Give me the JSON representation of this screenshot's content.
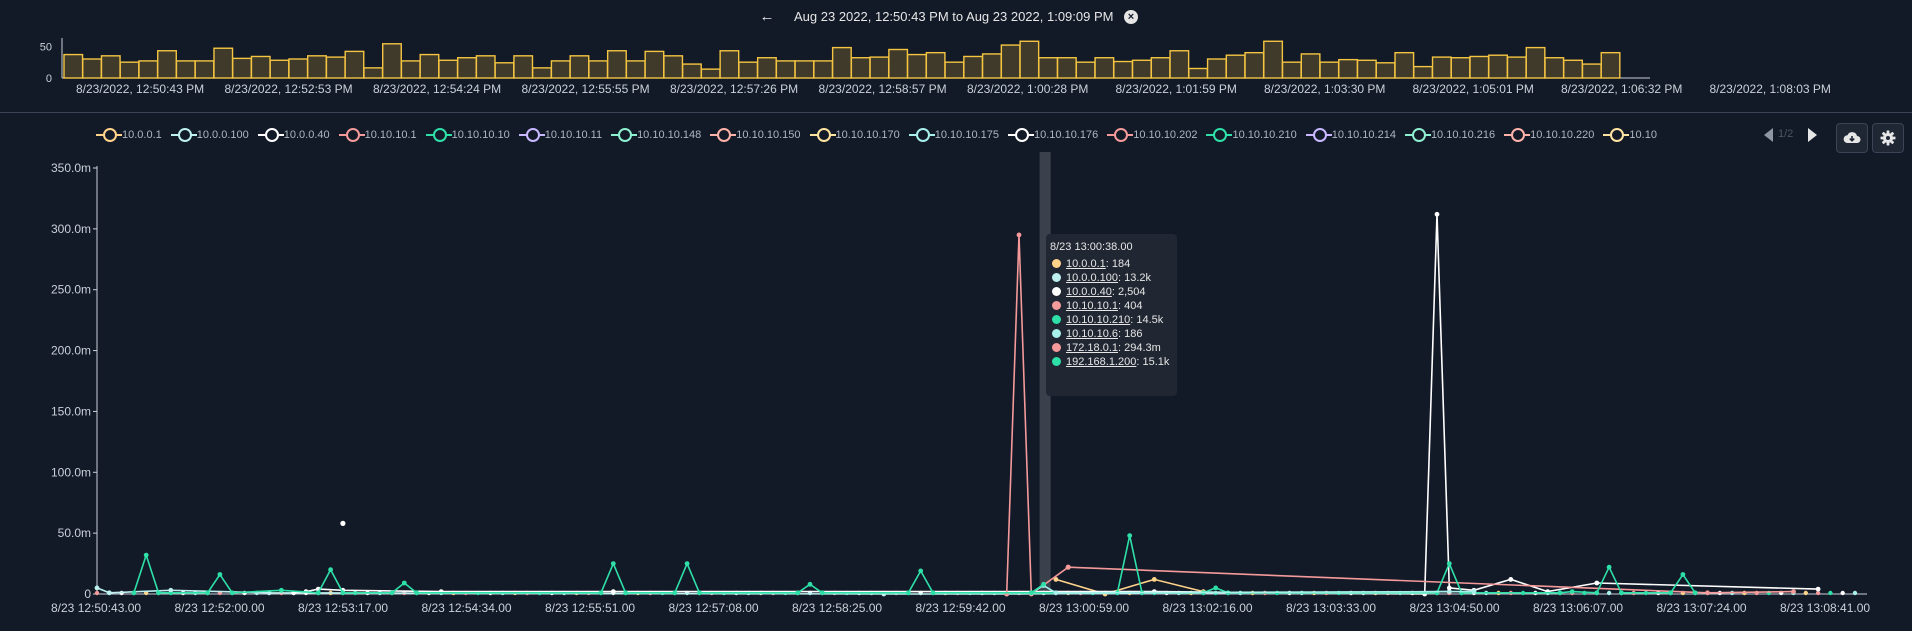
{
  "header": {
    "range_label": "Aug 23 2022, 12:50:43 PM to Aug 23 2022, 1:09:09 PM",
    "back_icon": "arrow-left-icon",
    "clear_icon": "close-circle-icon"
  },
  "colors": {
    "background": "#121927",
    "overview_bar_fill": "#3f3a2a",
    "overview_bar_stroke": "#f5c542",
    "axis": "#c9d1d9",
    "grid_label": "#c9d1d9",
    "highlight_band": "#3b414c"
  },
  "legend": {
    "items": [
      {
        "label": "10.0.0.1",
        "color": "#ffd38a"
      },
      {
        "label": "10.0.0.100",
        "color": "#bdf0ee"
      },
      {
        "label": "10.0.0.40",
        "color": "#ffffff"
      },
      {
        "label": "10.10.10.1",
        "color": "#f59a9a"
      },
      {
        "label": "10.10.10.10",
        "color": "#2ee0a8"
      },
      {
        "label": "10.10.10.11",
        "color": "#c9b8ff"
      },
      {
        "label": "10.10.10.148",
        "color": "#8ef0d0"
      },
      {
        "label": "10.10.10.150",
        "color": "#ffb3a8"
      },
      {
        "label": "10.10.10.170",
        "color": "#ffe3a0"
      },
      {
        "label": "10.10.10.175",
        "color": "#a8f0ec"
      },
      {
        "label": "10.10.10.176",
        "color": "#ffffff"
      },
      {
        "label": "10.10.10.202",
        "color": "#f59a9a"
      },
      {
        "label": "10.10.10.210",
        "color": "#2ee0a8"
      },
      {
        "label": "10.10.10.214",
        "color": "#c9b8ff"
      },
      {
        "label": "10.10.10.216",
        "color": "#8ef0d0"
      },
      {
        "label": "10.10.10.220",
        "color": "#ffb3a8"
      },
      {
        "label": "10.10",
        "color": "#ffe3a0"
      }
    ],
    "page_text": "1/2",
    "prev_icon": "triangle-left-icon",
    "next_icon": "triangle-right-icon"
  },
  "toolbar": {
    "download_icon": "cloud-download-icon",
    "settings_icon": "gear-icon"
  },
  "tooltip": {
    "title": "8/23 13:00:38.00",
    "rows": [
      {
        "host": "10.0.0.1",
        "value": ": 184",
        "color": "#ffd38a"
      },
      {
        "host": "10.0.0.100",
        "value": ": 13.2k",
        "color": "#bdf0ee"
      },
      {
        "host": "10.0.0.40",
        "value": ": 2,504",
        "color": "#ffffff"
      },
      {
        "host": "10.10.10.1",
        "value": ": 404",
        "color": "#f59a9a"
      },
      {
        "host": "10.10.10.210",
        "value": ": 14.5k",
        "color": "#2ee0a8"
      },
      {
        "host": "10.10.10.6",
        "value": ": 186",
        "color": "#a8f0ec"
      },
      {
        "host": "172.18.0.1",
        "value": ": 294.3m",
        "color": "#f59a9a"
      },
      {
        "host": "192.168.1.200",
        "value": ": 15.1k",
        "color": "#2ee0a8"
      }
    ]
  },
  "chart_data": [
    {
      "type": "bar",
      "name": "overview",
      "ylim": [
        0,
        60
      ],
      "y_ticks": [
        "50",
        "0"
      ],
      "y_tick_values": [
        50,
        0
      ],
      "x_tick_labels": [
        "8/23/2022, 12:50:43 PM",
        "8/23/2022, 12:52:53 PM",
        "8/23/2022, 12:54:24 PM",
        "8/23/2022, 12:55:55 PM",
        "8/23/2022, 12:57:26 PM",
        "8/23/2022, 12:58:57 PM",
        "8/23/2022, 1:00:28 PM",
        "8/23/2022, 1:01:59 PM",
        "8/23/2022, 1:03:30 PM",
        "8/23/2022, 1:05:01 PM",
        "8/23/2022, 1:06:32 PM",
        "8/23/2022, 1:08:03 PM"
      ],
      "values": [
        37,
        30,
        35,
        25,
        27,
        43,
        27,
        27,
        47,
        31,
        34,
        28,
        30,
        35,
        33,
        42,
        16,
        54,
        27,
        37,
        28,
        32,
        35,
        24,
        35,
        16,
        27,
        35,
        27,
        43,
        27,
        42,
        35,
        22,
        14,
        43,
        25,
        32,
        27,
        27,
        27,
        48,
        32,
        33,
        45,
        37,
        40,
        25,
        34,
        38,
        52,
        58,
        32,
        32,
        25,
        32,
        26,
        28,
        32,
        43,
        15,
        30,
        36,
        40,
        58,
        25,
        38,
        25,
        29,
        28,
        24,
        40,
        18,
        33,
        32,
        34,
        36,
        33,
        48,
        32,
        28,
        22,
        40
      ]
    },
    {
      "type": "line",
      "name": "main",
      "ylim": [
        0,
        350
      ],
      "y_ticks": [
        "350.0m",
        "300.0m",
        "250.0m",
        "200.0m",
        "150.0m",
        "100.0m",
        "50.0m",
        "0"
      ],
      "y_tick_values": [
        350,
        300,
        250,
        200,
        150,
        100,
        50,
        0
      ],
      "x_tick_labels": [
        "8/23 12:50:43.00",
        "8/23 12:52:00.00",
        "8/23 12:53:17.00",
        "8/23 12:54:34.00",
        "8/23 12:55:51.00",
        "8/23 12:57:08.00",
        "8/23 12:58:25.00",
        "8/23 12:59:42.00",
        "8/23 13:00:59.00",
        "8/23 13:02:16.00",
        "8/23 13:03:33.00",
        "8/23 13:04:50.00",
        "8/23 13:06:07.00",
        "8/23 13:07:24.00",
        "8/23 13:08:41.00"
      ],
      "highlight_index": 77,
      "n_points": 144,
      "series": [
        {
          "name": "10.0.0.1",
          "color": "#ffd38a",
          "points": [
            [
              78,
              12
            ],
            [
              82,
              0
            ],
            [
              86,
              12
            ],
            [
              90,
              2
            ]
          ]
        },
        {
          "name": "10.0.0.100",
          "color": "#bdf0ee",
          "points": [
            [
              0,
              5
            ],
            [
              1,
              1
            ],
            [
              6,
              3
            ],
            [
              14,
              1
            ],
            [
              64,
              0
            ],
            [
              74,
              0
            ],
            [
              110,
              2
            ]
          ]
        },
        {
          "name": "10.0.0.40",
          "color": "#ffffff",
          "points": [
            [
              16,
              1
            ],
            [
              17,
              2
            ],
            [
              18,
              4
            ],
            [
              20,
              3
            ],
            [
              28,
              2
            ],
            [
              42,
              2
            ],
            [
              86,
              2
            ],
            [
              108,
              0
            ],
            [
              109,
              312
            ],
            [
              110,
              5
            ],
            [
              112,
              3
            ],
            [
              115,
              12
            ],
            [
              118,
              2
            ],
            [
              122,
              9
            ],
            [
              140,
              4
            ]
          ]
        },
        {
          "name": "10.10.10.1",
          "color": "#f59a9a",
          "points": [
            [
              74,
              0
            ],
            [
              75,
              295
            ],
            [
              76,
              0
            ],
            [
              79,
              22
            ],
            [
              131,
              1
            ],
            [
              138,
              2
            ]
          ]
        },
        {
          "name": "10.10.10.210",
          "color": "#2ee0a8",
          "points": [
            [
              3,
              1
            ],
            [
              4,
              32
            ],
            [
              5,
              1
            ],
            [
              9,
              1
            ],
            [
              10,
              16
            ],
            [
              11,
              1
            ],
            [
              15,
              3
            ],
            [
              18,
              1
            ],
            [
              19,
              20
            ],
            [
              20,
              1
            ],
            [
              24,
              1
            ],
            [
              25,
              9
            ],
            [
              26,
              1
            ],
            [
              41,
              1
            ],
            [
              42,
              25
            ],
            [
              43,
              1
            ],
            [
              47,
              1
            ],
            [
              48,
              25
            ],
            [
              49,
              1
            ],
            [
              57,
              1
            ],
            [
              58,
              8
            ],
            [
              59,
              1
            ],
            [
              66,
              1
            ],
            [
              67,
              19
            ],
            [
              68,
              1
            ],
            [
              83,
              1
            ],
            [
              84,
              48
            ],
            [
              85,
              1
            ],
            [
              90,
              1
            ],
            [
              91,
              5
            ],
            [
              92,
              1
            ],
            [
              109,
              1
            ],
            [
              110,
              25
            ],
            [
              111,
              1
            ],
            [
              119,
              1
            ],
            [
              120,
              2
            ],
            [
              122,
              1
            ],
            [
              123,
              22
            ],
            [
              124,
              1
            ],
            [
              128,
              1
            ],
            [
              129,
              16
            ],
            [
              130,
              1
            ]
          ]
        },
        {
          "name": "10.10.10.6",
          "color": "#a8f0ec",
          "points": [
            [
              76,
              1
            ],
            [
              77,
              7
            ],
            [
              78,
              1
            ],
            [
              112,
              2
            ]
          ]
        },
        {
          "name": "192.168.1.200",
          "color": "#2ee0a8",
          "points": [
            [
              76,
              1
            ],
            [
              77,
              8
            ]
          ]
        }
      ],
      "scatter_points": [
        {
          "x": 20,
          "y": 58,
          "color": "#ffffff"
        },
        {
          "x": 79,
          "y": 22,
          "color": "#f59a9a"
        }
      ]
    }
  ]
}
